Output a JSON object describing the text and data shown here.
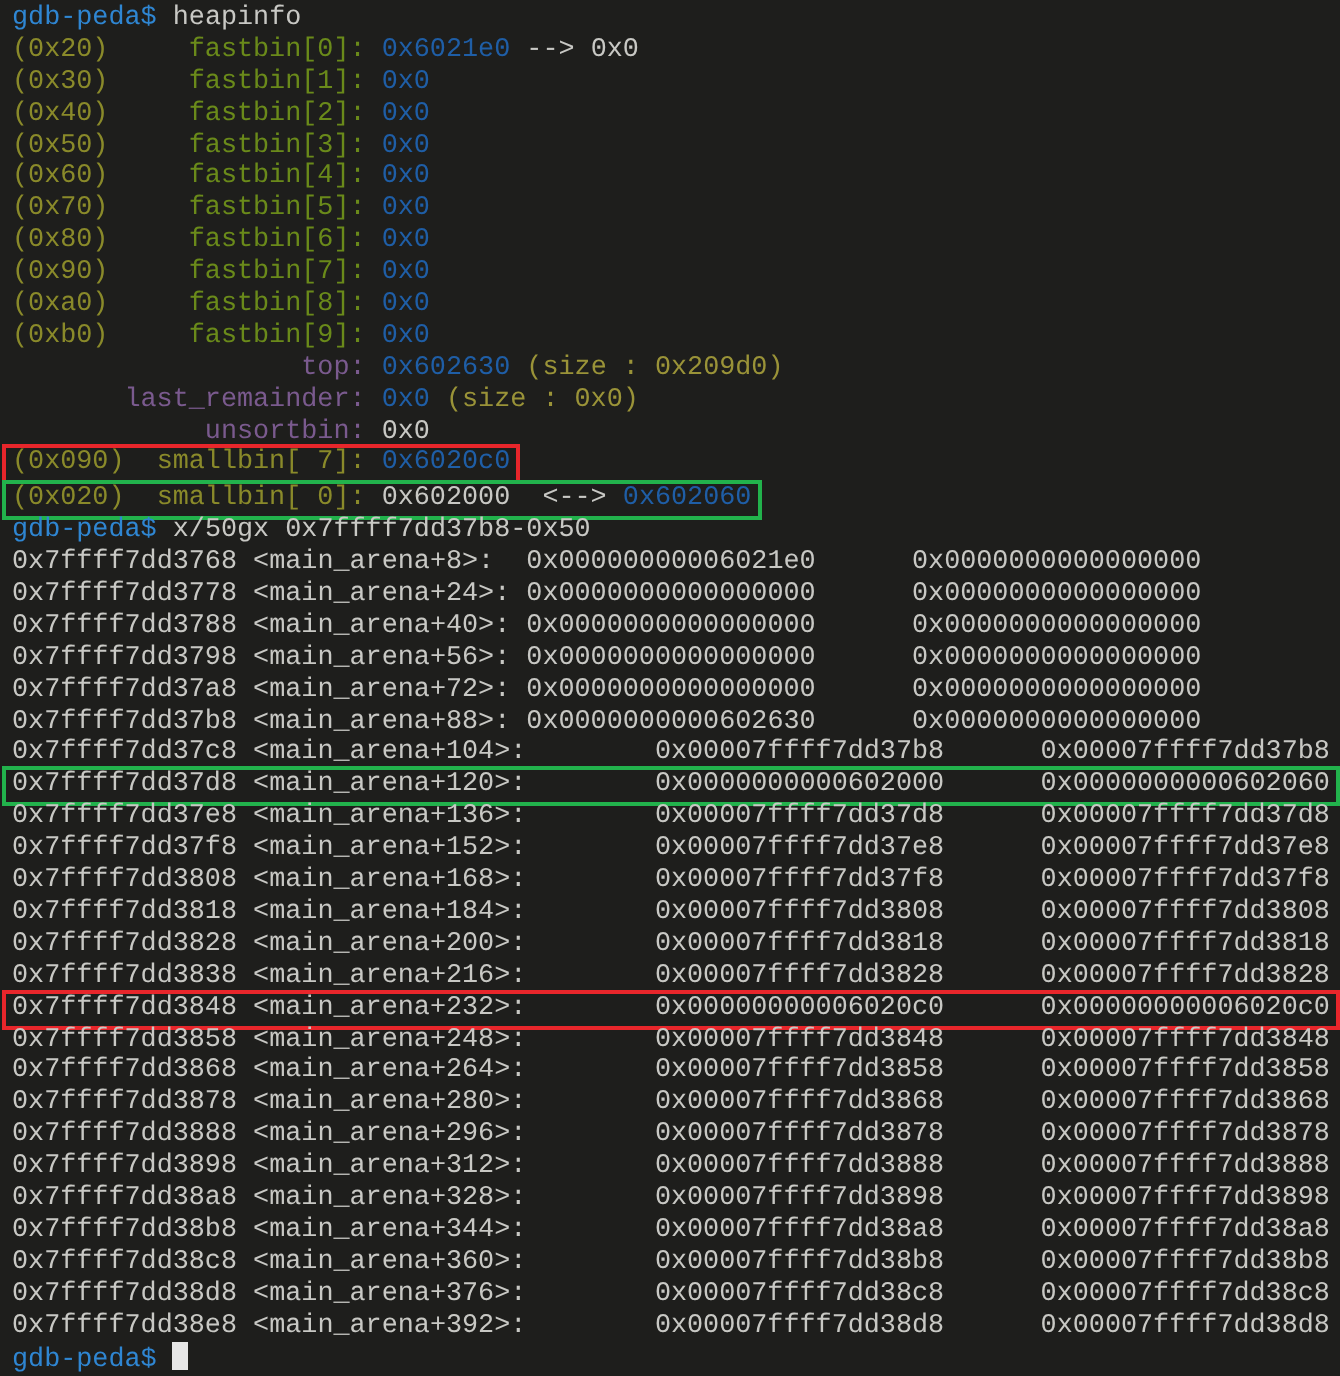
{
  "terminal": {
    "lines": [
      {
        "kind": "prompt",
        "prompt": "gdb-peda$",
        "command": "heapinfo"
      },
      {
        "kind": "bin",
        "size": "(0x20)",
        "label": {
          "text": "fastbin[0]:",
          "kind": "fastbin"
        },
        "values": [
          {
            "text": "0x6021e0",
            "kind": "pointer"
          },
          {
            "text": "-->",
            "kind": "plain"
          },
          {
            "text": "0x0",
            "kind": "plain"
          }
        ]
      },
      {
        "kind": "bin",
        "size": "(0x30)",
        "label": {
          "text": "fastbin[1]:",
          "kind": "fastbin"
        },
        "values": [
          {
            "text": "0x0",
            "kind": "pointer"
          }
        ]
      },
      {
        "kind": "bin",
        "size": "(0x40)",
        "label": {
          "text": "fastbin[2]:",
          "kind": "fastbin"
        },
        "values": [
          {
            "text": "0x0",
            "kind": "pointer"
          }
        ]
      },
      {
        "kind": "bin",
        "size": "(0x50)",
        "label": {
          "text": "fastbin[3]:",
          "kind": "fastbin"
        },
        "values": [
          {
            "text": "0x0",
            "kind": "pointer"
          }
        ]
      },
      {
        "kind": "bin",
        "size": "(0x60)",
        "label": {
          "text": "fastbin[4]:",
          "kind": "fastbin"
        },
        "values": [
          {
            "text": "0x0",
            "kind": "pointer"
          }
        ]
      },
      {
        "kind": "bin",
        "size": "(0x70)",
        "label": {
          "text": "fastbin[5]:",
          "kind": "fastbin"
        },
        "values": [
          {
            "text": "0x0",
            "kind": "pointer"
          }
        ]
      },
      {
        "kind": "bin",
        "size": "(0x80)",
        "label": {
          "text": "fastbin[6]:",
          "kind": "fastbin"
        },
        "values": [
          {
            "text": "0x0",
            "kind": "pointer"
          }
        ]
      },
      {
        "kind": "bin",
        "size": "(0x90)",
        "label": {
          "text": "fastbin[7]:",
          "kind": "fastbin"
        },
        "values": [
          {
            "text": "0x0",
            "kind": "pointer"
          }
        ]
      },
      {
        "kind": "bin",
        "size": "(0xa0)",
        "label": {
          "text": "fastbin[8]:",
          "kind": "fastbin"
        },
        "values": [
          {
            "text": "0x0",
            "kind": "pointer"
          }
        ]
      },
      {
        "kind": "bin",
        "size": "(0xb0)",
        "label": {
          "text": "fastbin[9]:",
          "kind": "fastbin"
        },
        "values": [
          {
            "text": "0x0",
            "kind": "pointer"
          }
        ]
      },
      {
        "kind": "bin",
        "label": {
          "text": "top:",
          "kind": "special"
        },
        "values": [
          {
            "text": "0x602630",
            "kind": "pointer"
          },
          {
            "text": "(size : 0x209d0)",
            "kind": "note"
          }
        ]
      },
      {
        "kind": "bin",
        "label": {
          "text": "last_remainder:",
          "kind": "special"
        },
        "values": [
          {
            "text": "0x0",
            "kind": "pointer"
          },
          {
            "text": "(size : 0x0)",
            "kind": "note"
          }
        ]
      },
      {
        "kind": "bin",
        "label": {
          "text": "unsortbin:",
          "kind": "special"
        },
        "values": [
          {
            "text": "0x0",
            "kind": "plain"
          }
        ]
      },
      {
        "kind": "bin",
        "size": "(0x090)",
        "label": {
          "text": "smallbin[ 7]:",
          "kind": "smallbin"
        },
        "color": "#e8262b",
        "values": [
          {
            "text": "0x6020c0",
            "kind": "pointer"
          }
        ]
      },
      {
        "kind": "bin",
        "size": "(0x020)",
        "label": {
          "text": "smallbin[ 0]:",
          "kind": "smallbin"
        },
        "color": "#22b24c",
        "values": [
          {
            "text": "0x602000",
            "kind": "plain"
          },
          {
            "text": "<-->",
            "kind": "plain"
          },
          {
            "text": "0x602060",
            "kind": "pointer"
          }
        ]
      },
      {
        "kind": "prompt",
        "prompt": "gdb-peda$",
        "command": "x/50gx 0x7ffff7dd37b8-0x50"
      },
      {
        "kind": "dump",
        "address": "0x7ffff7dd3768",
        "symbol": "<main_arena+8>:",
        "values": [
          "0x00000000006021e0",
          "0x0000000000000000"
        ]
      },
      {
        "kind": "dump",
        "address": "0x7ffff7dd3778",
        "symbol": "<main_arena+24>:",
        "values": [
          "0x0000000000000000",
          "0x0000000000000000"
        ]
      },
      {
        "kind": "dump",
        "address": "0x7ffff7dd3788",
        "symbol": "<main_arena+40>:",
        "values": [
          "0x0000000000000000",
          "0x0000000000000000"
        ]
      },
      {
        "kind": "dump",
        "address": "0x7ffff7dd3798",
        "symbol": "<main_arena+56>:",
        "values": [
          "0x0000000000000000",
          "0x0000000000000000"
        ]
      },
      {
        "kind": "dump",
        "address": "0x7ffff7dd37a8",
        "symbol": "<main_arena+72>:",
        "values": [
          "0x0000000000000000",
          "0x0000000000000000"
        ]
      },
      {
        "kind": "dump",
        "address": "0x7ffff7dd37b8",
        "symbol": "<main_arena+88>:",
        "values": [
          "0x0000000000602630",
          "0x0000000000000000"
        ]
      },
      {
        "kind": "dump",
        "address": "0x7ffff7dd37c8",
        "symbol": "<main_arena+104>:",
        "values": [
          "0x00007ffff7dd37b8",
          "0x00007ffff7dd37b8"
        ]
      },
      {
        "kind": "dump",
        "address": "0x7ffff7dd37d8",
        "symbol": "<main_arena+120>:",
        "color": "#22b24c",
        "values": [
          "0x0000000000602000",
          "0x0000000000602060"
        ]
      },
      {
        "kind": "dump",
        "address": "0x7ffff7dd37e8",
        "symbol": "<main_arena+136>:",
        "values": [
          "0x00007ffff7dd37d8",
          "0x00007ffff7dd37d8"
        ]
      },
      {
        "kind": "dump",
        "address": "0x7ffff7dd37f8",
        "symbol": "<main_arena+152>:",
        "values": [
          "0x00007ffff7dd37e8",
          "0x00007ffff7dd37e8"
        ]
      },
      {
        "kind": "dump",
        "address": "0x7ffff7dd3808",
        "symbol": "<main_arena+168>:",
        "values": [
          "0x00007ffff7dd37f8",
          "0x00007ffff7dd37f8"
        ]
      },
      {
        "kind": "dump",
        "address": "0x7ffff7dd3818",
        "symbol": "<main_arena+184>:",
        "values": [
          "0x00007ffff7dd3808",
          "0x00007ffff7dd3808"
        ]
      },
      {
        "kind": "dump",
        "address": "0x7ffff7dd3828",
        "symbol": "<main_arena+200>:",
        "values": [
          "0x00007ffff7dd3818",
          "0x00007ffff7dd3818"
        ]
      },
      {
        "kind": "dump",
        "address": "0x7ffff7dd3838",
        "symbol": "<main_arena+216>:",
        "values": [
          "0x00007ffff7dd3828",
          "0x00007ffff7dd3828"
        ]
      },
      {
        "kind": "dump",
        "address": "0x7ffff7dd3848",
        "symbol": "<main_arena+232>:",
        "color": "#e8262b",
        "values": [
          "0x00000000006020c0",
          "0x00000000006020c0"
        ]
      },
      {
        "kind": "dump",
        "address": "0x7ffff7dd3858",
        "symbol": "<main_arena+248>:",
        "values": [
          "0x00007ffff7dd3848",
          "0x00007ffff7dd3848"
        ]
      },
      {
        "kind": "dump",
        "address": "0x7ffff7dd3868",
        "symbol": "<main_arena+264>:",
        "values": [
          "0x00007ffff7dd3858",
          "0x00007ffff7dd3858"
        ]
      },
      {
        "kind": "dump",
        "address": "0x7ffff7dd3878",
        "symbol": "<main_arena+280>:",
        "values": [
          "0x00007ffff7dd3868",
          "0x00007ffff7dd3868"
        ]
      },
      {
        "kind": "dump",
        "address": "0x7ffff7dd3888",
        "symbol": "<main_arena+296>:",
        "values": [
          "0x00007ffff7dd3878",
          "0x00007ffff7dd3878"
        ]
      },
      {
        "kind": "dump",
        "address": "0x7ffff7dd3898",
        "symbol": "<main_arena+312>:",
        "values": [
          "0x00007ffff7dd3888",
          "0x00007ffff7dd3888"
        ]
      },
      {
        "kind": "dump",
        "address": "0x7ffff7dd38a8",
        "symbol": "<main_arena+328>:",
        "values": [
          "0x00007ffff7dd3898",
          "0x00007ffff7dd3898"
        ]
      },
      {
        "kind": "dump",
        "address": "0x7ffff7dd38b8",
        "symbol": "<main_arena+344>:",
        "values": [
          "0x00007ffff7dd38a8",
          "0x00007ffff7dd38a8"
        ]
      },
      {
        "kind": "dump",
        "address": "0x7ffff7dd38c8",
        "symbol": "<main_arena+360>:",
        "values": [
          "0x00007ffff7dd38b8",
          "0x00007ffff7dd38b8"
        ]
      },
      {
        "kind": "dump",
        "address": "0x7ffff7dd38d8",
        "symbol": "<main_arena+376>:",
        "values": [
          "0x00007ffff7dd38c8",
          "0x00007ffff7dd38c8"
        ]
      },
      {
        "kind": "dump",
        "address": "0x7ffff7dd38e8",
        "symbol": "<main_arena+392>:",
        "values": [
          "0x00007ffff7dd38d8",
          "0x00007ffff7dd38d8"
        ]
      },
      {
        "kind": "prompt",
        "prompt": "gdb-peda$",
        "cursor": true
      }
    ]
  }
}
